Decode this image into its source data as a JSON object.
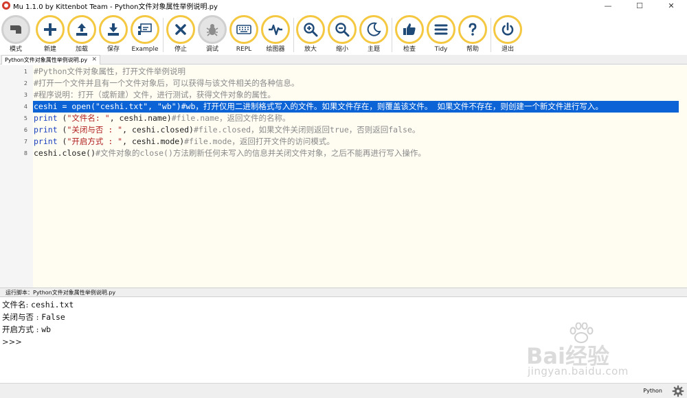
{
  "window": {
    "title": "Mu 1.1.0 by Kittenbot Team - Python文件对象属性举例说明.py",
    "controls": [
      "—",
      "☐",
      "✕"
    ]
  },
  "toolbar": {
    "buttons": [
      {
        "label": "模式",
        "icon": "mode-icon"
      },
      {
        "label": "新建",
        "icon": "plus-icon"
      },
      {
        "label": "加载",
        "icon": "upload-icon"
      },
      {
        "label": "保存",
        "icon": "download-icon"
      },
      {
        "label": "Example",
        "icon": "presentation-icon"
      },
      {
        "label": "停止",
        "icon": "close-icon"
      },
      {
        "label": "调试",
        "icon": "bug-icon"
      },
      {
        "label": "REPL",
        "icon": "keyboard-icon"
      },
      {
        "label": "绘图器",
        "icon": "pulse-icon"
      },
      {
        "label": "放大",
        "icon": "zoom-in-icon"
      },
      {
        "label": "缩小",
        "icon": "zoom-out-icon"
      },
      {
        "label": "主题",
        "icon": "moon-icon"
      },
      {
        "label": "检查",
        "icon": "thumbs-up-icon"
      },
      {
        "label": "Tidy",
        "icon": "lines-icon"
      },
      {
        "label": "帮助",
        "icon": "question-icon"
      },
      {
        "label": "退出",
        "icon": "power-icon"
      }
    ]
  },
  "tabs": [
    {
      "label": "Python文件对象属性举例说明.py",
      "close": "✕"
    }
  ],
  "editor": {
    "line_numbers": [
      "1",
      "2",
      "3",
      "4",
      "5",
      "6",
      "7",
      "8"
    ],
    "lines": {
      "l1": "#Python文件对象属性，打开文件举例说明",
      "l2": "#打开一个文件并且有一个文件对象后，可以获得与该文件相关的各种信息。",
      "l3": "#程序说明：打开（或新建）文件，进行测试，获得文件对象的属性。",
      "l4": "ceshi = open(\"ceshi.txt\", \"wb\")#wb，打开仅用二进制格式写入的文件。如果文件存在，则覆盖该文件。 如果文件不存在，则创建一个新文件进行写入。",
      "l5": {
        "kw": "print",
        "open": " (",
        "str": "\"文件名: \"",
        "rest": ", ceshi.name)",
        "comment": "#file.name，返回文件的名称。"
      },
      "l6": {
        "kw": "print",
        "open": " (",
        "str": "\"关闭与否 : \"",
        "rest": ", ceshi.closed)",
        "comment": "#file.closed，如果文件关闭则返回true，否则返回false。"
      },
      "l7": {
        "kw": "print",
        "open": " (",
        "str": "\"开启方式 : \"",
        "rest": ", ceshi.mode)",
        "comment": "#file.mode，返回打开文件的访问模式。"
      },
      "l8": {
        "code": "ceshi.close()",
        "comment": "#文件对象的close()方法刷新任何未写入的信息并关闭文件对象，之后不能再进行写入操作。"
      }
    }
  },
  "output_pane": {
    "title": "运行脚本：Python文件对象属性举例说明.py",
    "lines": [
      {
        "label": "文件名: ",
        "value": "ceshi.txt"
      },
      {
        "label": "关闭与否 : ",
        "value": "False"
      },
      {
        "label": "开启方式 : ",
        "value": "wb"
      }
    ],
    "prompt": ">>>"
  },
  "watermark": {
    "brand": "Bai经验",
    "url": "jingyan.baidu.com"
  },
  "statusbar": {
    "mode": "Python",
    "settings_icon": "gear-icon"
  },
  "colors": {
    "accent": "#f5c842",
    "selection": "#0b63d6",
    "keyword": "#1a3fbf",
    "string": "#b02020",
    "comment": "#8a8a8a",
    "editor_bg": "#fffdf2"
  }
}
